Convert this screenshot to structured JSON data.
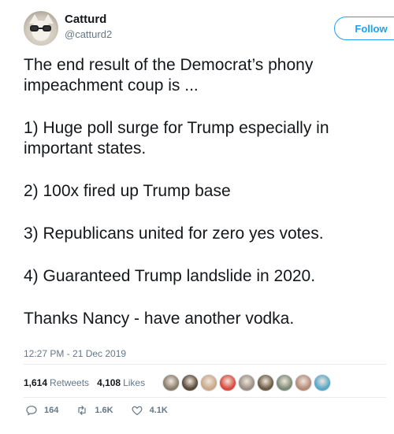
{
  "user": {
    "name": "Catturd",
    "handle": "@catturd2",
    "follow_label": "Follow"
  },
  "tweet": {
    "paragraphs": [
      "The end result of the Democrat’s phony impeachment coup is ...",
      "1) Huge poll surge for Trump especially in important states.",
      "2) 100x fired up Trump base",
      "3) Republicans united for zero yes votes.",
      "4) Guaranteed Trump landslide in 2020.",
      "Thanks Nancy - have another vodka."
    ],
    "timestamp": "12:27 PM - 21 Dec 2019"
  },
  "stats": {
    "retweets_count": "1,614",
    "retweets_label": "Retweets",
    "likes_count": "4,108",
    "likes_label": "Likes"
  },
  "likers": [
    {
      "icon": "liker-avatar",
      "color": "#8a7d6b"
    },
    {
      "icon": "liker-avatar",
      "color": "#5b4a3a"
    },
    {
      "icon": "liker-avatar",
      "color": "#c9a98a"
    },
    {
      "icon": "liker-avatar",
      "color": "#d94b3d"
    },
    {
      "icon": "liker-avatar",
      "color": "#9c8f86"
    },
    {
      "icon": "liker-avatar",
      "color": "#6b5a44"
    },
    {
      "icon": "liker-avatar",
      "color": "#7d8a76"
    },
    {
      "icon": "liker-avatar",
      "color": "#b58a78"
    },
    {
      "icon": "liker-avatar",
      "color": "#5aa7c9"
    }
  ],
  "actions": {
    "replies": "164",
    "retweets": "1.6K",
    "likes": "4.1K"
  },
  "colors": {
    "accent": "#1da1f2",
    "secondary_text": "#657786",
    "primary_text": "#14171a"
  }
}
